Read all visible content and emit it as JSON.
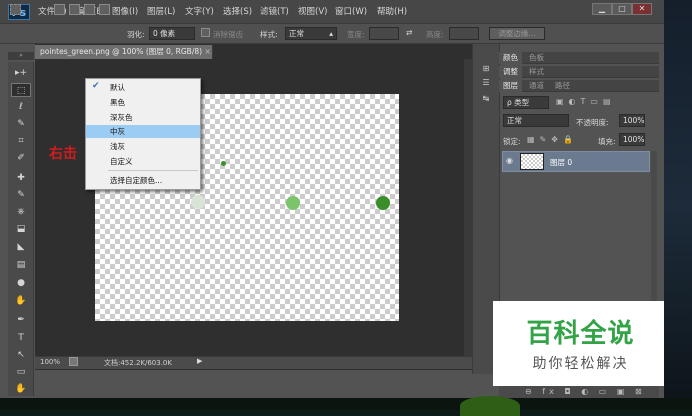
{
  "app": {
    "logo": "Ps"
  },
  "menu": [
    "文件(F)",
    "编辑(E)",
    "图像(I)",
    "图层(L)",
    "文字(Y)",
    "选择(S)",
    "滤镜(T)",
    "视图(V)",
    "窗口(W)",
    "帮助(H)"
  ],
  "window_buttons": [
    "▁",
    "□",
    "✕"
  ],
  "options": {
    "feather_label": "羽化:",
    "feather_value": "0 像素",
    "antialias_label": "消除锯齿",
    "style_label": "样式:",
    "style_value": "正常",
    "width_label": "宽度:",
    "height_label": "高度:",
    "refine_edge": "调整边缘..."
  },
  "document": {
    "tab_title": "pointes_green.png @ 100% (图层 0, RGB/8)",
    "tab_close": "×",
    "zoom": "100%",
    "status_text": "文档:452.2K/603.0K"
  },
  "context_menu": {
    "items": [
      "默认",
      "黑色",
      "深灰色",
      "中灰",
      "浅灰",
      "自定义"
    ],
    "extra": "选择自定颜色...",
    "checked_item": "默认",
    "highlighted_item": "中灰",
    "check_mark": "✔"
  },
  "annotation": "右击",
  "tools": [
    "▸+",
    "⬚",
    "ℓ",
    "✎",
    "⌗",
    "✐",
    "✚",
    "✎",
    "⎈",
    "⬓",
    "◣",
    "▤",
    "●",
    "✋",
    "♦",
    "✒",
    "T",
    "↖",
    "▭",
    "✋",
    "🔍"
  ],
  "right_strip_icons": [
    "⊞",
    "☰",
    "↹",
    "◉"
  ],
  "panels": {
    "tabs1": [
      "颜色",
      "色板"
    ],
    "tabs2": [
      "调整",
      "样式"
    ],
    "tabs3": [
      "图层",
      "通道",
      "路径"
    ],
    "kind_label": "ρ 类型",
    "blend_mode": "正常",
    "opacity_label": "不透明度:",
    "opacity_value": "100%",
    "lock_label": "锁定:",
    "fill_label": "填充:",
    "fill_value": "100%",
    "layer_name": "图层 0",
    "bottom_icons": "⊖ fx ◘ ◐ ▭ ▣ ⊠"
  },
  "watermark": {
    "title": "百科全说",
    "subtitle": "助你轻松解决"
  },
  "colors": {
    "highlight": "#9bcdf4",
    "dot_dark": "#3a8f2a",
    "dot_light": "#7cc46a",
    "annotation": "#d21c1c",
    "brand": "#33a347"
  }
}
